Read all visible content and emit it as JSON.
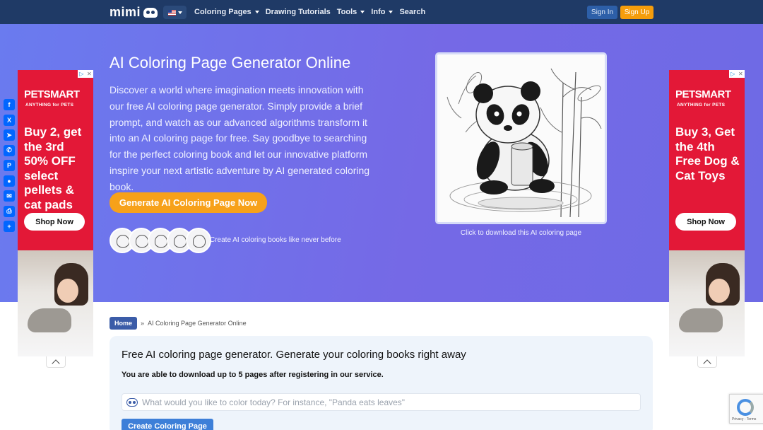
{
  "nav": {
    "logo_text": "mimi",
    "language": "en-US",
    "links": [
      {
        "label": "Coloring Pages",
        "dropdown": true
      },
      {
        "label": "Drawing Tutorials",
        "dropdown": false
      },
      {
        "label": "Tools",
        "dropdown": true
      },
      {
        "label": "Info",
        "dropdown": true
      },
      {
        "label": "Search",
        "dropdown": false
      }
    ],
    "sign_in": "Sign In",
    "sign_up": "Sign Up"
  },
  "hero": {
    "title": "AI Coloring Page Generator Online",
    "description": "Discover a world where imagination meets innovation with our free AI coloring page generator. Simply provide a brief prompt, and watch as our advanced algorithms transform it into an AI coloring page for free. Say goodbye to searching for the perfect coloring book and let our innovative platform inspire your next artistic adventure by AI generated coloring book.",
    "cta": "Generate AI Coloring Page Now",
    "thumbs_caption": "Create AI coloring books like never before",
    "preview_caption": "Click to download this AI coloring page"
  },
  "share_buttons": [
    {
      "name": "facebook-icon",
      "glyph": "f"
    },
    {
      "name": "x-icon",
      "glyph": "X"
    },
    {
      "name": "telegram-icon",
      "glyph": "➤"
    },
    {
      "name": "whatsapp-icon",
      "glyph": "✆"
    },
    {
      "name": "pinterest-icon",
      "glyph": "P"
    },
    {
      "name": "reddit-icon",
      "glyph": "●"
    },
    {
      "name": "email-icon",
      "glyph": "✉"
    },
    {
      "name": "print-icon",
      "glyph": "⎙"
    },
    {
      "name": "share-icon",
      "glyph": "+"
    }
  ],
  "ads": {
    "left": {
      "brand": "PETSMART",
      "tagline": "ANYTHING for PETS",
      "headline": "Buy 2, get the 3rd 50% OFF select pellets & cat pads",
      "button": "Shop Now"
    },
    "right": {
      "brand": "PETSMART",
      "tagline": "ANYTHING for PETS",
      "headline": "Buy 3, Get the 4th Free Dog & Cat Toys",
      "button": "Shop Now"
    }
  },
  "breadcrumb": {
    "home": "Home",
    "separator": "»",
    "current": "AI Coloring Page Generator Online"
  },
  "generator": {
    "title": "Free AI coloring page generator. Generate your coloring books right away",
    "note": "You are able to download up to 5 pages after registering in our service.",
    "placeholder": "What would you like to color today? For instance, \"Panda eats leaves\"",
    "button": "Create Coloring Page"
  },
  "recaptcha": {
    "text": "Privacy - Terms"
  },
  "colors": {
    "nav_bg": "#1f3a66",
    "hero_start": "#6a7bef",
    "hero_end": "#7569e6",
    "cta": "#f7a11a",
    "ad_red": "#e31837",
    "share_blue": "#0166ff"
  }
}
